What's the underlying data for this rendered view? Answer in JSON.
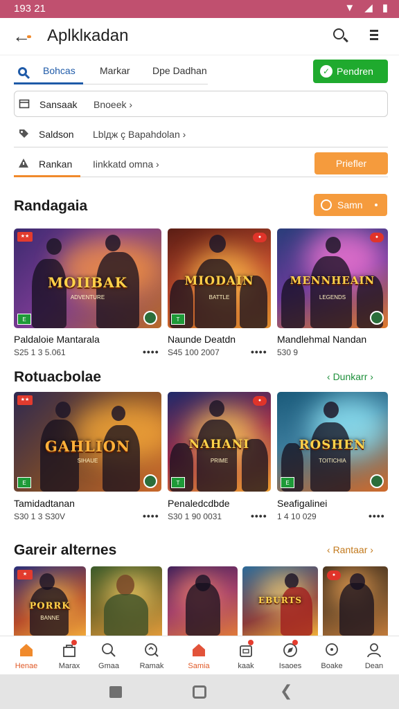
{
  "status": {
    "time": "193 21"
  },
  "app_bar": {
    "title": "Aplklĸadan"
  },
  "tabs": [
    {
      "label": "Bohcas",
      "active": true
    },
    {
      "label": "Markar"
    },
    {
      "label": "Dpe Dadhan"
    }
  ],
  "top_action": {
    "label": "Pendren",
    "color": "#1faa2e"
  },
  "filters": [
    {
      "label": "Sansaak",
      "value": "Bnoeek ›"
    },
    {
      "label": "Saldson",
      "value": "Lblдж ç Bapahdolan ›"
    },
    {
      "label": "Rankan",
      "value": "Iinkkatd omna ›",
      "button": "Priefler"
    }
  ],
  "sections": [
    {
      "title": "Randagaia",
      "action": "Samn",
      "cards": [
        {
          "name": "Paldaloie Mantarala",
          "meta": "S25 1 3 5.061",
          "more": "••••",
          "logo": "MOIIBAK",
          "sub": "ADVENTURE"
        },
        {
          "name": "Naunde Deatdn",
          "meta": "S45 100 2007",
          "more": "••••",
          "logo": "MIODAIN",
          "sub": "BATTLE"
        },
        {
          "name": "Mandlehmal Nandan",
          "meta": "530 9",
          "more": "",
          "logo": "MENNHEAIN",
          "sub": "LEGENDS"
        }
      ]
    },
    {
      "title": "Rotuacbolae",
      "link": "Dunkarr",
      "cards": [
        {
          "name": "Tamidadtanan",
          "meta": "S30 1 3 S30V",
          "more": "••••",
          "logo": "GAHLION",
          "sub": "SIHAUE"
        },
        {
          "name": "Penaledcdbde",
          "meta": "S30 1 90 0031",
          "more": "••••",
          "logo": "NAHANI",
          "sub": "PRIME"
        },
        {
          "name": "Seafigalinei",
          "meta": "1 4 10 029",
          "more": "••••",
          "logo": "ROSHEN",
          "sub": "TOITICHIA"
        }
      ]
    },
    {
      "title": "Gareir alternes",
      "link": "Rantaar",
      "tiles": [
        {
          "logo": "PORRK",
          "sub": "BANNE"
        },
        {
          "logo": "",
          "sub": ""
        },
        {
          "logo": "",
          "sub": ""
        },
        {
          "logo": "EBURTS",
          "sub": ""
        },
        {
          "logo": "",
          "sub": ""
        }
      ]
    }
  ],
  "bottom_nav": [
    {
      "label": "Henae",
      "icon": "home-icon",
      "active": true
    },
    {
      "label": "Marax",
      "icon": "store-icon",
      "badge": true
    },
    {
      "label": "Gmaa",
      "icon": "search-icon"
    },
    {
      "label": "Ramak",
      "icon": "discover-icon"
    },
    {
      "label": "Samia",
      "icon": "home-red-icon",
      "active": true
    },
    {
      "label": "kaak",
      "icon": "bag-icon",
      "badge": true
    },
    {
      "label": "Isaoes",
      "icon": "compass-icon"
    },
    {
      "label": "Boake",
      "icon": "chat-icon"
    },
    {
      "label": "Dean",
      "icon": "profile-icon"
    }
  ]
}
